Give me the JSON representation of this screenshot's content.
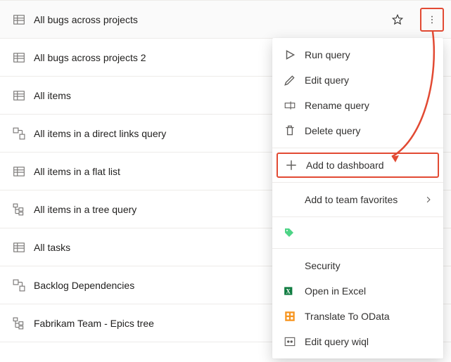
{
  "queries": [
    {
      "label": "All bugs across projects",
      "icon": "flat",
      "selected": true,
      "star": true,
      "more": true
    },
    {
      "label": "All bugs across projects 2",
      "icon": "flat"
    },
    {
      "label": "All items",
      "icon": "flat"
    },
    {
      "label": "All items in a direct links query",
      "icon": "links"
    },
    {
      "label": "All items in a flat list",
      "icon": "flat"
    },
    {
      "label": "All items in a tree query",
      "icon": "tree"
    },
    {
      "label": "All tasks",
      "icon": "flat"
    },
    {
      "label": "Backlog Dependencies",
      "icon": "links"
    },
    {
      "label": "Fabrikam Team - Epics tree",
      "icon": "tree"
    }
  ],
  "menu": {
    "run": "Run query",
    "edit": "Edit query",
    "rename": "Rename query",
    "delete": "Delete query",
    "add_dash": "Add to dashboard",
    "add_fav": "Add to team favorites",
    "security": "Security",
    "excel": "Open in Excel",
    "odata": "Translate To OData",
    "wiql": "Edit query wiql"
  }
}
